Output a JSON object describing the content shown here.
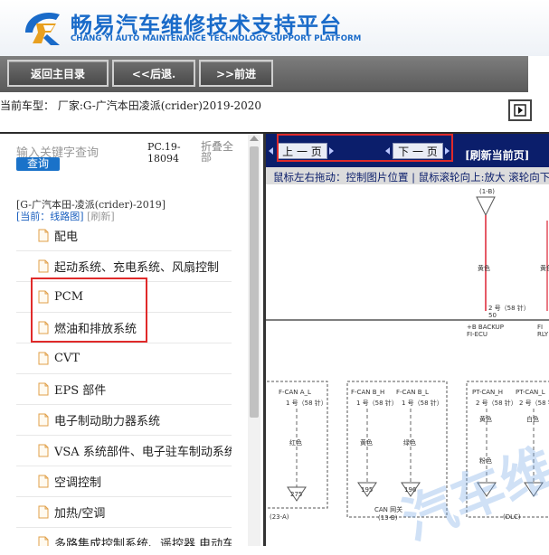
{
  "header": {
    "title_cn": "畅易汽车维修技术支持平台",
    "title_en": "CHANG YI AUTO MAINTENANCE TECHNOLOGY SUPPORT PLATFORM",
    "logo": "logo-icon"
  },
  "nav": {
    "home": "返回主目录",
    "back": "<<后退.",
    "forward": ">>前进"
  },
  "vehicle": {
    "label": "当前车型：",
    "value": "厂家:G-广汽本田凌派(crider)2019-2020"
  },
  "left_panel": {
    "search_placeholder": "输入关键字查询",
    "search_button": "查询",
    "pc_code": "PC.19-18094",
    "collapse_all": "折叠全部",
    "tree_root": "[G-广汽本田-凌派(crider)-2019]",
    "current_label": "[当前：线路图]",
    "refresh_label": "[刷新]",
    "items": [
      {
        "label": "配电"
      },
      {
        "label": "起动系统、充电系统、风扇控制"
      },
      {
        "label": "PCM"
      },
      {
        "label": "燃油和排放系统"
      },
      {
        "label": "CVT"
      },
      {
        "label": "EPS 部件"
      },
      {
        "label": "电子制动助力器系统"
      },
      {
        "label": "VSA 系统部件、电子驻车制动系统部件"
      },
      {
        "label": "空调控制"
      },
      {
        "label": "加热/空调"
      },
      {
        "label": "多路集成控制系统、遥控器 电动车门"
      }
    ],
    "highlight_color": "#e02a2a"
  },
  "viewer": {
    "prev_page": "上 一 页",
    "next_page": "下 一 页",
    "refresh_page": "[刷新当前页]",
    "hint": "鼠标左右拖动：控制图片位置 | 鼠标滚轮向上:放大  滚轮向下:缩小",
    "bar_color": "#0b1e6b",
    "diagram": {
      "top_connector": "(1-B)",
      "wire_color_1": "黄色",
      "wire_spec_1": "2 号（58 针）",
      "pin_1": "50",
      "label_backup": "+B BACKUP",
      "label_fi": "FI-ECU",
      "label_fi_right": "FI",
      "label_rly": "RLY",
      "label_fcan_al": "F-CAN A_L",
      "label_fcan_bh": "F-CAN B_H",
      "label_fcan_bl": "F-CAN B_L",
      "label_ptcan_h": "PT-CAN_H",
      "label_ptcan_l": "PT-CAN_L",
      "wire_spec_a": "1 号（58 针）",
      "wire_spec_b": "2 号（58 针）",
      "color_red": "红色",
      "color_yellow": "黄色",
      "color_green": "绿色",
      "color_white": "白色",
      "color_pink": "粉色",
      "conn_275": "275",
      "conn_195": "195",
      "conn_196": "196",
      "can_hub": "CAN 网关",
      "can_hub_id": "(13-B)",
      "conn_23a": "(23-A)",
      "dlc": "(DLC)",
      "watermark": "汽车维"
    }
  }
}
